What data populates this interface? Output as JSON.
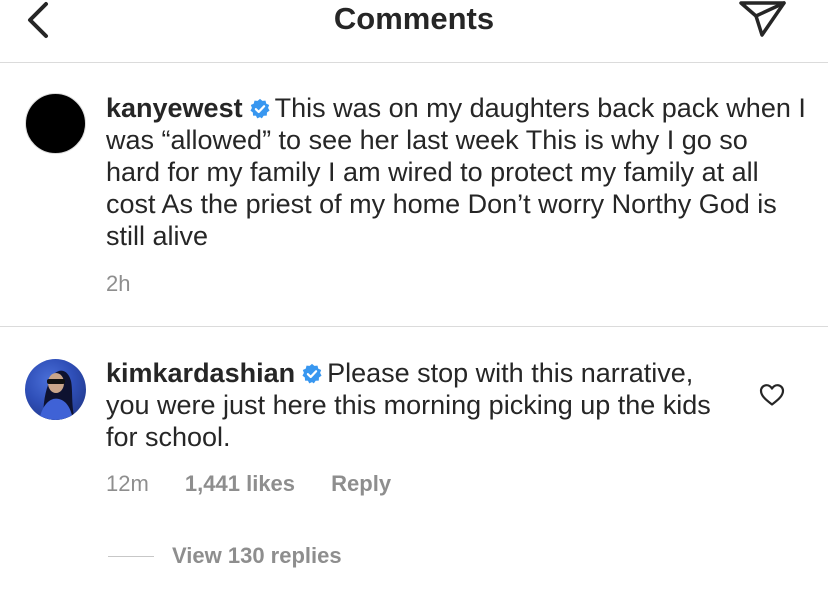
{
  "header": {
    "title": "Comments",
    "back_icon": "chevron-left-icon",
    "send_icon": "paper-plane-icon"
  },
  "comments": [
    {
      "username": "kanyewest",
      "verified": true,
      "text": "This was on my daughters back pack when I was “allowed” to see her last week  This is why I go so hard for my family  I am wired to protect my family at all cost  As the priest of my home  Don’t worry Northy  God is still alive",
      "time": "2h"
    },
    {
      "username": "kimkardashian",
      "verified": true,
      "text": "Please stop with this narrative, you were just here this morning picking up the kids for school.",
      "time": "12m",
      "likes": "1,441 likes",
      "reply_label": "Reply",
      "view_replies": "View 130 replies"
    }
  ],
  "colors": {
    "text": "#262626",
    "secondary": "#8e8e8e",
    "verified_badge": "#3897f0",
    "divider": "#dbdbdb"
  }
}
